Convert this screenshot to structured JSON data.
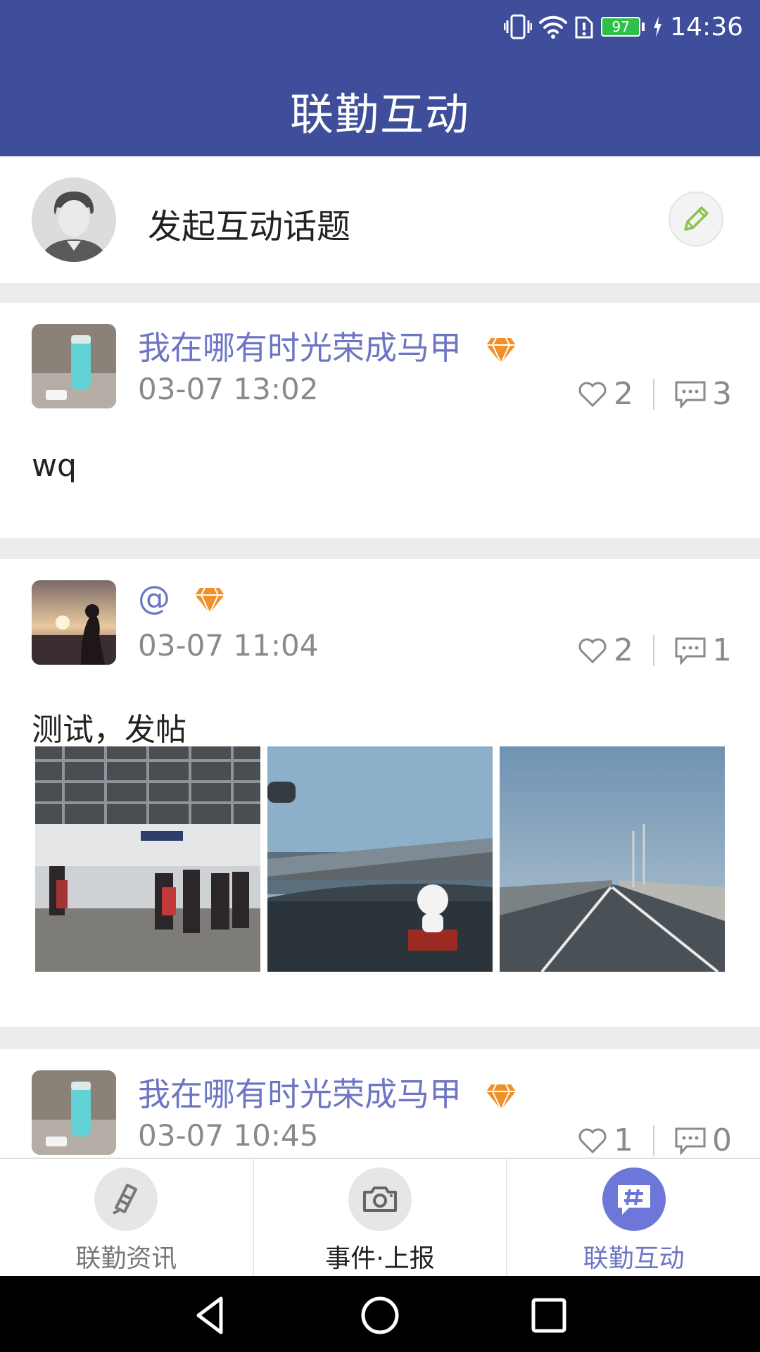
{
  "status_bar": {
    "battery": "97",
    "time": "14:36",
    "icons": [
      "vibrate-icon",
      "wifi-icon",
      "sim-alert-icon",
      "battery-icon",
      "charging-icon"
    ]
  },
  "header": {
    "title": "联勤互动"
  },
  "compose": {
    "label": "发起互动话题",
    "icon": "pencil-icon"
  },
  "posts": [
    {
      "author": "我在哪有时光荣成马甲",
      "time": "03-07 13:02",
      "likes": "2",
      "comments": "3",
      "content": "wq"
    },
    {
      "author": "@",
      "time": "03-07 11:04",
      "likes": "2",
      "comments": "1",
      "content": "测试，发帖",
      "photos": [
        "station-photo",
        "car-dashboard-photo",
        "highway-photo"
      ]
    },
    {
      "author": "我在哪有时光荣成马甲",
      "time": "03-07 10:45",
      "likes": "1",
      "comments": "0"
    }
  ],
  "tabs": [
    {
      "label": "联勤资讯",
      "icon": "news-icon"
    },
    {
      "label": "事件·上报",
      "icon": "camera-icon"
    },
    {
      "label": "联勤互动",
      "icon": "hashtag-chat-icon",
      "active": true
    }
  ],
  "colors": {
    "header": "#3f4e9a",
    "accent": "#6d76c4",
    "gem": "#f0902a"
  }
}
